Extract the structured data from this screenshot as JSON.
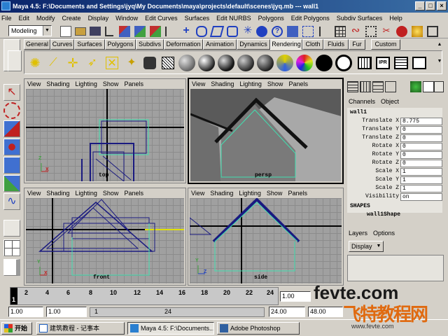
{
  "window": {
    "title": "Maya 4.5: F:\\Documents and Settings\\jyq\\My Documents\\maya\\projects\\default\\scenes\\jyq.mb  ---  wall1"
  },
  "menu": [
    "File",
    "Edit",
    "Modify",
    "Create",
    "Display",
    "Window",
    "Edit Curves",
    "Surfaces",
    "Edit NURBS",
    "Polygons",
    "Edit Polygons",
    "Subdiv Surfaces",
    "Help"
  ],
  "status": {
    "mode": "Modeling"
  },
  "shelf_tabs": [
    "General",
    "Curves",
    "Surfaces",
    "Polygons",
    "Subdivs",
    "Deformation",
    "Animation",
    "Dynamics",
    "Rendering",
    "Cloth",
    "Fluids",
    "Fur",
    "Custom"
  ],
  "active_shelf_tab": "Rendering",
  "viewport_menu": [
    "View",
    "Shading",
    "Lighting",
    "Show",
    "Panels"
  ],
  "viewports": {
    "top": {
      "label": "top"
    },
    "persp": {
      "label": "persp"
    },
    "front": {
      "label": "front"
    },
    "side": {
      "label": "side"
    }
  },
  "axis": {
    "x": "X",
    "y": "Y",
    "z": "Z"
  },
  "channel_box": {
    "tabs": [
      "Channels",
      "Object"
    ],
    "object_name": "wall1",
    "attributes": [
      {
        "name": "Translate X",
        "value": "8.775"
      },
      {
        "name": "Translate Y",
        "value": "0"
      },
      {
        "name": "Translate Z",
        "value": "0"
      },
      {
        "name": "Rotate X",
        "value": "0"
      },
      {
        "name": "Rotate Y",
        "value": "0"
      },
      {
        "name": "Rotate Z",
        "value": "0"
      },
      {
        "name": "Scale X",
        "value": "1"
      },
      {
        "name": "Scale Y",
        "value": "1"
      },
      {
        "name": "Scale Z",
        "value": "1"
      },
      {
        "name": "Visibility",
        "value": "on"
      }
    ],
    "shapes_header": "SHAPES",
    "shape_name": "wall1Shape"
  },
  "layers": {
    "menu": [
      "Layers",
      "Options"
    ],
    "display": "Display"
  },
  "time_slider": {
    "ticks": [
      "2",
      "4",
      "6",
      "8",
      "10",
      "12",
      "14",
      "16",
      "18",
      "20",
      "22",
      "24"
    ],
    "current": "1",
    "current_frame_field": "1.00"
  },
  "range": {
    "start": "1.00",
    "start2": "1.00",
    "inner_start": "1",
    "inner_end": "24",
    "end": "24.00",
    "end2": "48.00"
  },
  "taskbar": {
    "start": "开始",
    "items": [
      "建筑教程 - 记事本",
      "Maya 4.5: F:\\Documents...",
      "Adobe Photoshop"
    ]
  },
  "watermark": {
    "site": "fevte.com",
    "cn": "飞特教程网",
    "sub": "www.fevte.com"
  },
  "colors": {
    "title_bar": "#0a246a",
    "wireframe": "#1a1a80",
    "selected_wire": "#40e0b0",
    "grid": "#a0a0a0"
  }
}
